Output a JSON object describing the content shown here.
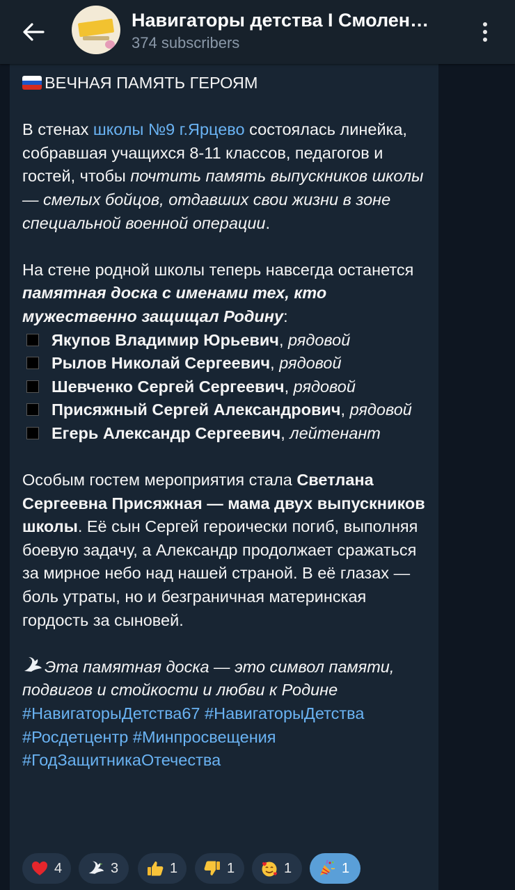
{
  "header": {
    "channel_name": "Навигаторы детства I Смолен…",
    "subscribers": "374 subscribers",
    "back_icon": "arrow-left-icon",
    "menu_icon": "kebab-menu-icon"
  },
  "post": {
    "heading": "ВЕЧНАЯ ПАМЯТЬ ГЕРОЯМ",
    "p1_a": "В стенах ",
    "p1_link": "школы №9 г.Ярцево",
    "p1_b": " состоялась линейка, собравшая учащихся 8-11 классов, педагогов и гостей, чтобы ",
    "p1_italic": "почтить память выпускников школы — смелых бойцов, отдавших свои жизни в зоне специальной военной операции",
    "p1_end": ".",
    "p2_a": "На стене родной школы теперь навсегда останется ",
    "p2_bold_italic": "памятная доска с именами тех, кто мужественно защищал Родину",
    "p2_end": ":",
    "names": [
      {
        "name": "Якупов Владимир Юрьевич",
        "rank": "рядовой"
      },
      {
        "name": "Рылов Николай Сергеевич",
        "rank": "рядовой"
      },
      {
        "name": "Шевченко Сергей Сергеевич",
        "rank": "рядовой"
      },
      {
        "name": "Присяжный Сергей Александрович",
        "rank": "рядовой"
      },
      {
        "name": "Егерь Александр Сергеевич",
        "rank": "лейтенант"
      }
    ],
    "p3_a": "Особым гостем мероприятия стала ",
    "p3_bold": "Светлана Сергеевна Присяжная — мама двух выпускников школы",
    "p3_b": ". Её сын Сергей героически погиб, выполняя боевую задачу, а Александр продолжает сражаться за мирное небо над нашей страной. В её глазах — боль утраты, но и безграничная материнская гордость за сыновей.",
    "p4_italic": "Эта памятная доска — это символ памяти, подвигов и стойкости и любви к Родине",
    "hashtags_line1_a": "#НавигаторыДетства67",
    "hashtags_line1_b": "#НавигаторыДетства",
    "hashtags_line2_a": "#Росдетцентр",
    "hashtags_line2_b": "#Минпросвещения",
    "hashtags_line3": "#ГодЗащитникаОтечества"
  },
  "reactions": [
    {
      "icon": "red-heart-icon",
      "count": "4"
    },
    {
      "icon": "dove-icon",
      "count": "3"
    },
    {
      "icon": "thumbs-up-icon",
      "count": "1"
    },
    {
      "icon": "thumbs-down-icon",
      "count": "1"
    },
    {
      "icon": "smiling-face-with-hearts-icon",
      "count": "1"
    },
    {
      "icon": "party-popper-icon",
      "count": "1"
    }
  ],
  "colors": {
    "background": "#0e1621",
    "header": "#17212b",
    "bubble": "#182533",
    "link": "#6ab3f3",
    "reaction_active": "#5a9fd8"
  }
}
